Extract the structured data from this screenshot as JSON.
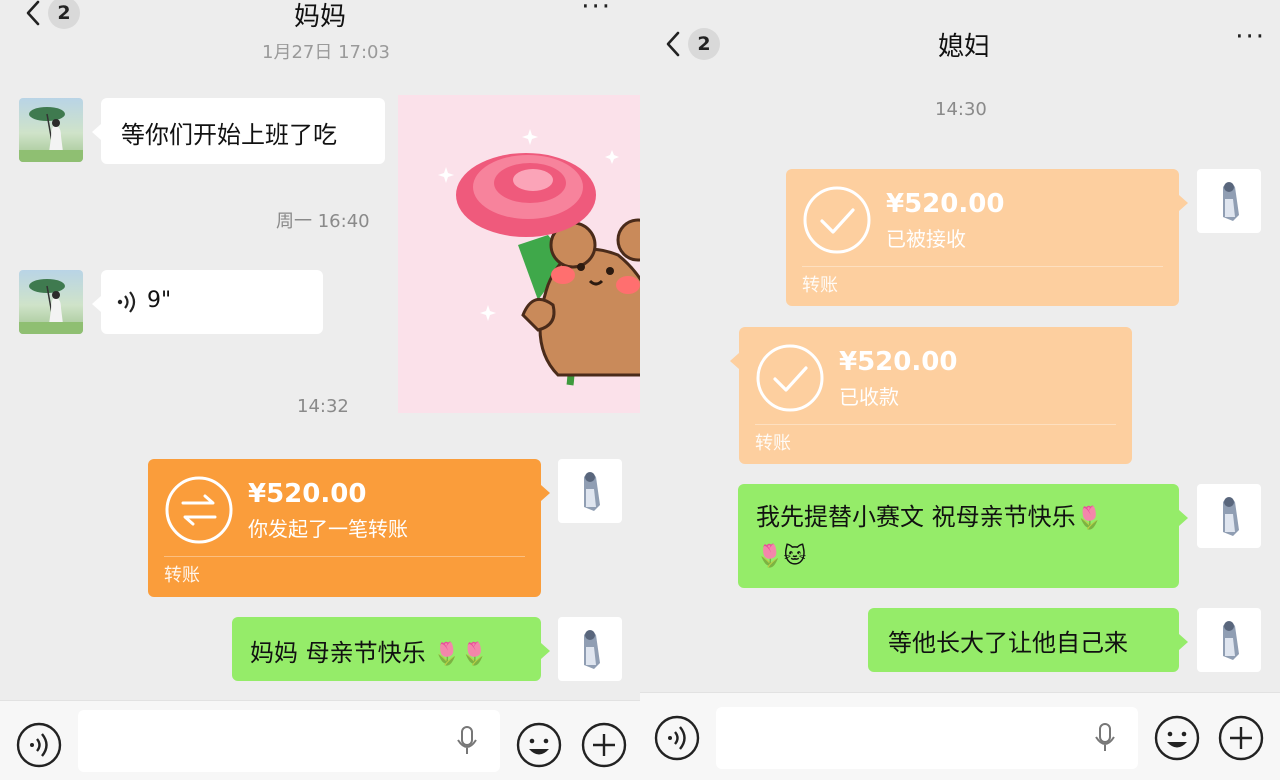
{
  "colors": {
    "background": "#ededed",
    "green_bubble": "#95ec69",
    "transfer_orange": "#fa9d3b",
    "transfer_received": "#fdcf9f"
  },
  "left": {
    "header": {
      "back_count": "2",
      "title": "妈妈",
      "more": "···"
    },
    "messages": [
      {
        "from": "mom",
        "text": "等你们开始上班了吃"
      },
      {
        "time": "周一 16:40"
      },
      {
        "from": "mom",
        "voice_duration": "9\""
      },
      {
        "time": "14:32"
      },
      {
        "from": "me",
        "transfer": {
          "amount": "¥520.00",
          "status": "你发起了一笔转账",
          "label": "转账"
        }
      },
      {
        "from": "me",
        "text": "妈妈 母亲节快乐",
        "emoji": "🌷🌷"
      }
    ]
  },
  "right": {
    "header": {
      "back_count": "2",
      "title": "媳妇",
      "more": "···"
    },
    "messages": [
      {
        "time": "14:30"
      },
      {
        "from": "me",
        "transfer": {
          "amount": "¥520.00",
          "status": "已被接收",
          "label": "转账"
        }
      },
      {
        "from": "wife",
        "transfer": {
          "amount": "¥520.00",
          "status": "已收款",
          "label": "转账"
        }
      },
      {
        "from": "me",
        "text_line1": "我先提替小赛文 祝母亲节快乐",
        "emoji_line1": "🌷",
        "emoji_line2": "🌷🐱"
      },
      {
        "from": "me",
        "text": "等他长大了让他自己来"
      }
    ]
  }
}
